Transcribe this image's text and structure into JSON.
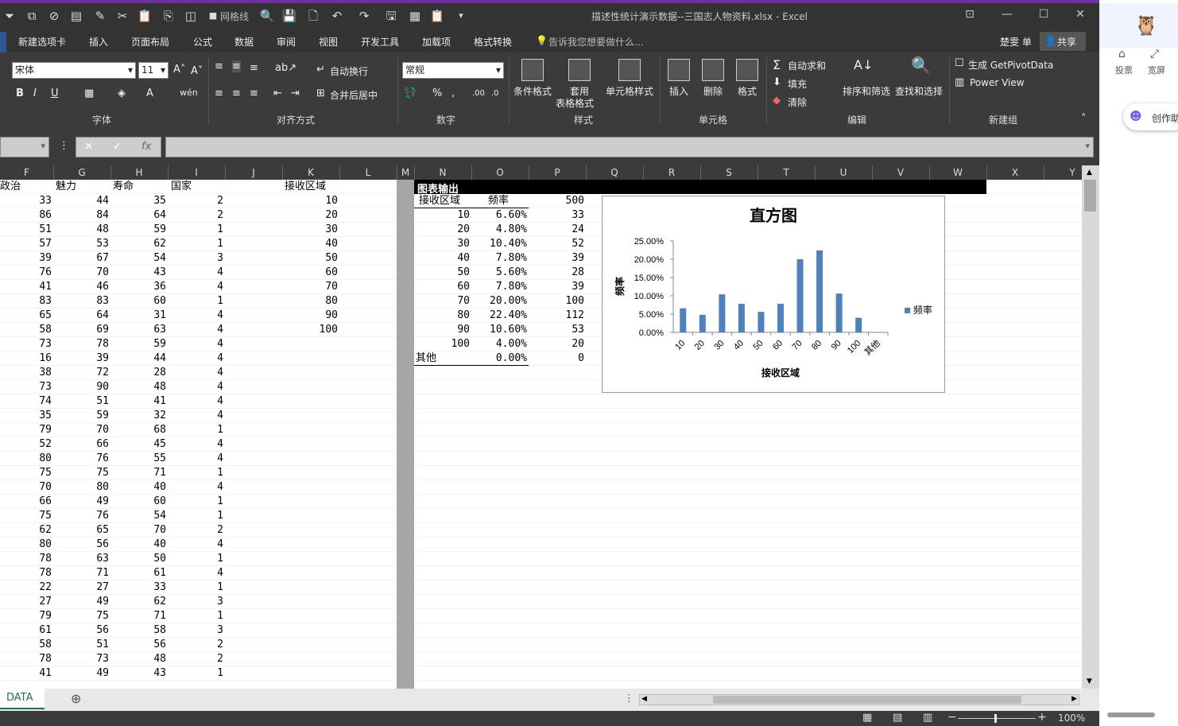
{
  "window": {
    "title": "描述性统计演示数据--三国志人物资料.xlsx - Excel",
    "qa_label": "网格线"
  },
  "tabs": [
    "新建选项卡",
    "插入",
    "页面布局",
    "公式",
    "数据",
    "审阅",
    "视图",
    "开发工具",
    "加载项",
    "格式转换"
  ],
  "tell_me": "告诉我您想要做什么...",
  "user": "楚雯 单",
  "share": "共享",
  "ribbon": {
    "font_name": "宋体",
    "font_size": "11",
    "wrap": "自动换行",
    "merge": "合并后居中",
    "number_format": "常规",
    "cond_format": "条件格式",
    "table_format_1": "套用",
    "table_format_2": "表格格式",
    "cell_style": "单元格样式",
    "insert": "插入",
    "delete": "删除",
    "format": "格式",
    "autosum": "自动求和",
    "fill": "填充",
    "clear": "清除",
    "sort": "排序和筛选",
    "find": "查找和选择",
    "pivot": "生成 GetPivotData",
    "powerview": "Power View",
    "groups": {
      "font": "字体",
      "align": "对齐方式",
      "number": "数字",
      "style": "样式",
      "cells": "单元格",
      "edit": "编辑",
      "newgroup": "新建组"
    }
  },
  "columns_left": [
    "F",
    "G",
    "H",
    "I",
    "J",
    "K",
    "L",
    "M"
  ],
  "columns_right": [
    "N",
    "O",
    "P",
    "Q",
    "R",
    "S",
    "T",
    "U",
    "V",
    "W",
    "X",
    "Y"
  ],
  "headers": {
    "F": "政治",
    "G": "魅力",
    "H": "寿命",
    "I": "国家",
    "K": "接收区域"
  },
  "rows": [
    [
      33,
      44,
      35,
      2,
      10
    ],
    [
      86,
      84,
      64,
      2,
      20
    ],
    [
      51,
      48,
      59,
      1,
      30
    ],
    [
      57,
      53,
      62,
      1,
      40
    ],
    [
      39,
      67,
      54,
      3,
      50
    ],
    [
      76,
      70,
      43,
      4,
      60
    ],
    [
      41,
      46,
      36,
      4,
      70
    ],
    [
      83,
      83,
      60,
      1,
      80
    ],
    [
      65,
      64,
      31,
      4,
      90
    ],
    [
      58,
      69,
      63,
      4,
      100
    ],
    [
      73,
      78,
      59,
      4,
      null
    ],
    [
      16,
      39,
      44,
      4,
      null
    ],
    [
      38,
      72,
      28,
      4,
      null
    ],
    [
      73,
      90,
      48,
      4,
      null
    ],
    [
      74,
      51,
      41,
      4,
      null
    ],
    [
      35,
      59,
      32,
      4,
      null
    ],
    [
      79,
      70,
      68,
      1,
      null
    ],
    [
      52,
      66,
      45,
      4,
      null
    ],
    [
      80,
      76,
      55,
      4,
      null
    ],
    [
      75,
      75,
      71,
      1,
      null
    ],
    [
      70,
      80,
      40,
      4,
      null
    ],
    [
      66,
      49,
      60,
      1,
      null
    ],
    [
      75,
      76,
      54,
      1,
      null
    ],
    [
      62,
      65,
      70,
      2,
      null
    ],
    [
      80,
      56,
      40,
      4,
      null
    ],
    [
      78,
      63,
      50,
      1,
      null
    ],
    [
      78,
      71,
      61,
      4,
      null
    ],
    [
      22,
      27,
      33,
      1,
      null
    ],
    [
      27,
      49,
      62,
      3,
      null
    ],
    [
      79,
      75,
      71,
      1,
      null
    ],
    [
      61,
      56,
      58,
      3,
      null
    ],
    [
      58,
      51,
      56,
      2,
      null
    ],
    [
      78,
      73,
      48,
      2,
      null
    ],
    [
      41,
      49,
      43,
      1,
      null
    ]
  ],
  "output": {
    "title": "图表输出",
    "col_bin": "接收区域",
    "col_freq": "频率",
    "total": "500",
    "rows": [
      {
        "bin": "10",
        "pct": "6.60%",
        "cnt": "33"
      },
      {
        "bin": "20",
        "pct": "4.80%",
        "cnt": "24"
      },
      {
        "bin": "30",
        "pct": "10.40%",
        "cnt": "52"
      },
      {
        "bin": "40",
        "pct": "7.80%",
        "cnt": "39"
      },
      {
        "bin": "50",
        "pct": "5.60%",
        "cnt": "28"
      },
      {
        "bin": "60",
        "pct": "7.80%",
        "cnt": "39"
      },
      {
        "bin": "70",
        "pct": "20.00%",
        "cnt": "100"
      },
      {
        "bin": "80",
        "pct": "22.40%",
        "cnt": "112"
      },
      {
        "bin": "90",
        "pct": "10.60%",
        "cnt": "53"
      },
      {
        "bin": "100",
        "pct": "4.00%",
        "cnt": "20"
      },
      {
        "bin": "其他",
        "pct": "0.00%",
        "cnt": "0"
      }
    ]
  },
  "chart_data": {
    "type": "bar",
    "title": "直方图",
    "xlabel": "接收区域",
    "ylabel": "频率",
    "categories": [
      "10",
      "20",
      "30",
      "40",
      "50",
      "60",
      "70",
      "80",
      "90",
      "100",
      "其他"
    ],
    "series": [
      {
        "name": "频率",
        "values": [
          6.6,
          4.8,
          10.4,
          7.8,
          5.6,
          7.8,
          20.0,
          22.4,
          10.6,
          4.0,
          0.0
        ]
      }
    ],
    "yticks": [
      "0.00%",
      "5.00%",
      "10.00%",
      "15.00%",
      "20.00%",
      "25.00%"
    ],
    "ylim": [
      0,
      25
    ],
    "legend": "right",
    "color": "#4f81bd"
  },
  "sheet_tab": "DATA",
  "zoom": "100%",
  "right_panel": {
    "cast": "投票",
    "wide": "宽屏",
    "create": "创作助"
  }
}
